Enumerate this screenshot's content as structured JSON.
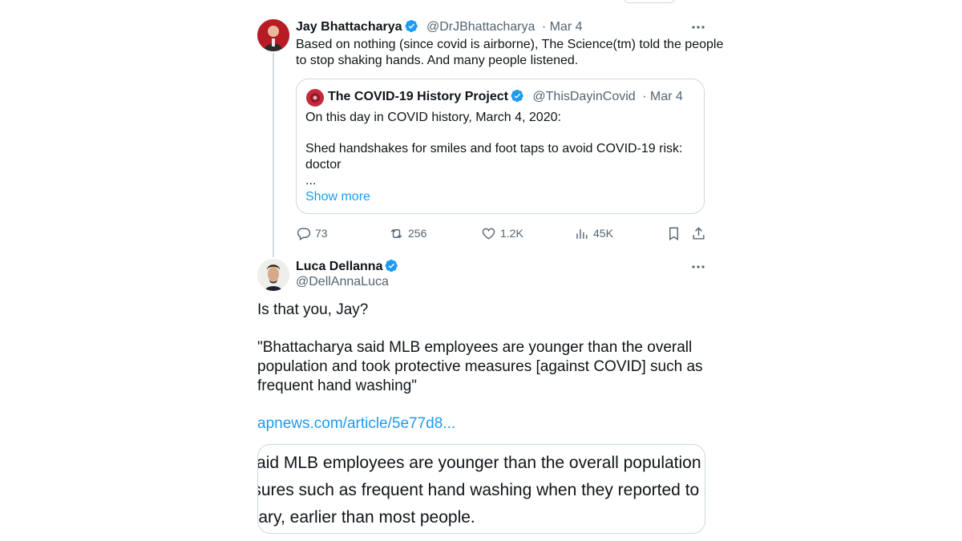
{
  "tweet1": {
    "author_name": "Jay Bhattacharya",
    "handle": "@DrJBhattacharya",
    "date": "· Mar 4",
    "text_line1": "Based on nothing (since covid is airborne), The Science(tm) told the people",
    "text_line2": "to stop shaking hands. And many people listened.",
    "quote": {
      "author_name": "The COVID-19 History Project",
      "handle": "@ThisDayinCovid",
      "date": "· Mar 4",
      "line1": "On this day in COVID history, March 4, 2020:",
      "line2": "Shed handshakes for smiles and foot taps to avoid COVID-19 risk:",
      "line3": "doctor",
      "line4": "...",
      "show_more": "Show more"
    },
    "actions": {
      "replies": "73",
      "retweets": "256",
      "likes": "1.2K",
      "views": "45K"
    }
  },
  "tweet2": {
    "author_name": "Luca Dellanna",
    "handle": "@DellAnnaLuca",
    "para1": "Is that you, Jay?",
    "para2_line1": "\"Bhattacharya said MLB employees are younger than the overall",
    "para2_line2": "population and took protective measures [against COVID] such as",
    "para2_line3": "frequent hand washing\"",
    "link": "apnews.com/article/5e77d8...",
    "preview": {
      "line1": "a said MLB employees are younger than the overall population and",
      "line2": "easures such as frequent hand washing when they reported to spri",
      "line3": "bruary, earlier than most people."
    }
  },
  "colors": {
    "accent": "#1d9bf0",
    "text": "#0f1419",
    "muted": "#536471",
    "border": "#cfd9de"
  },
  "icons": [
    "verified-badge-icon",
    "more-options-icon",
    "reply-icon",
    "retweet-icon",
    "like-icon",
    "views-icon",
    "bookmark-icon",
    "share-icon"
  ]
}
